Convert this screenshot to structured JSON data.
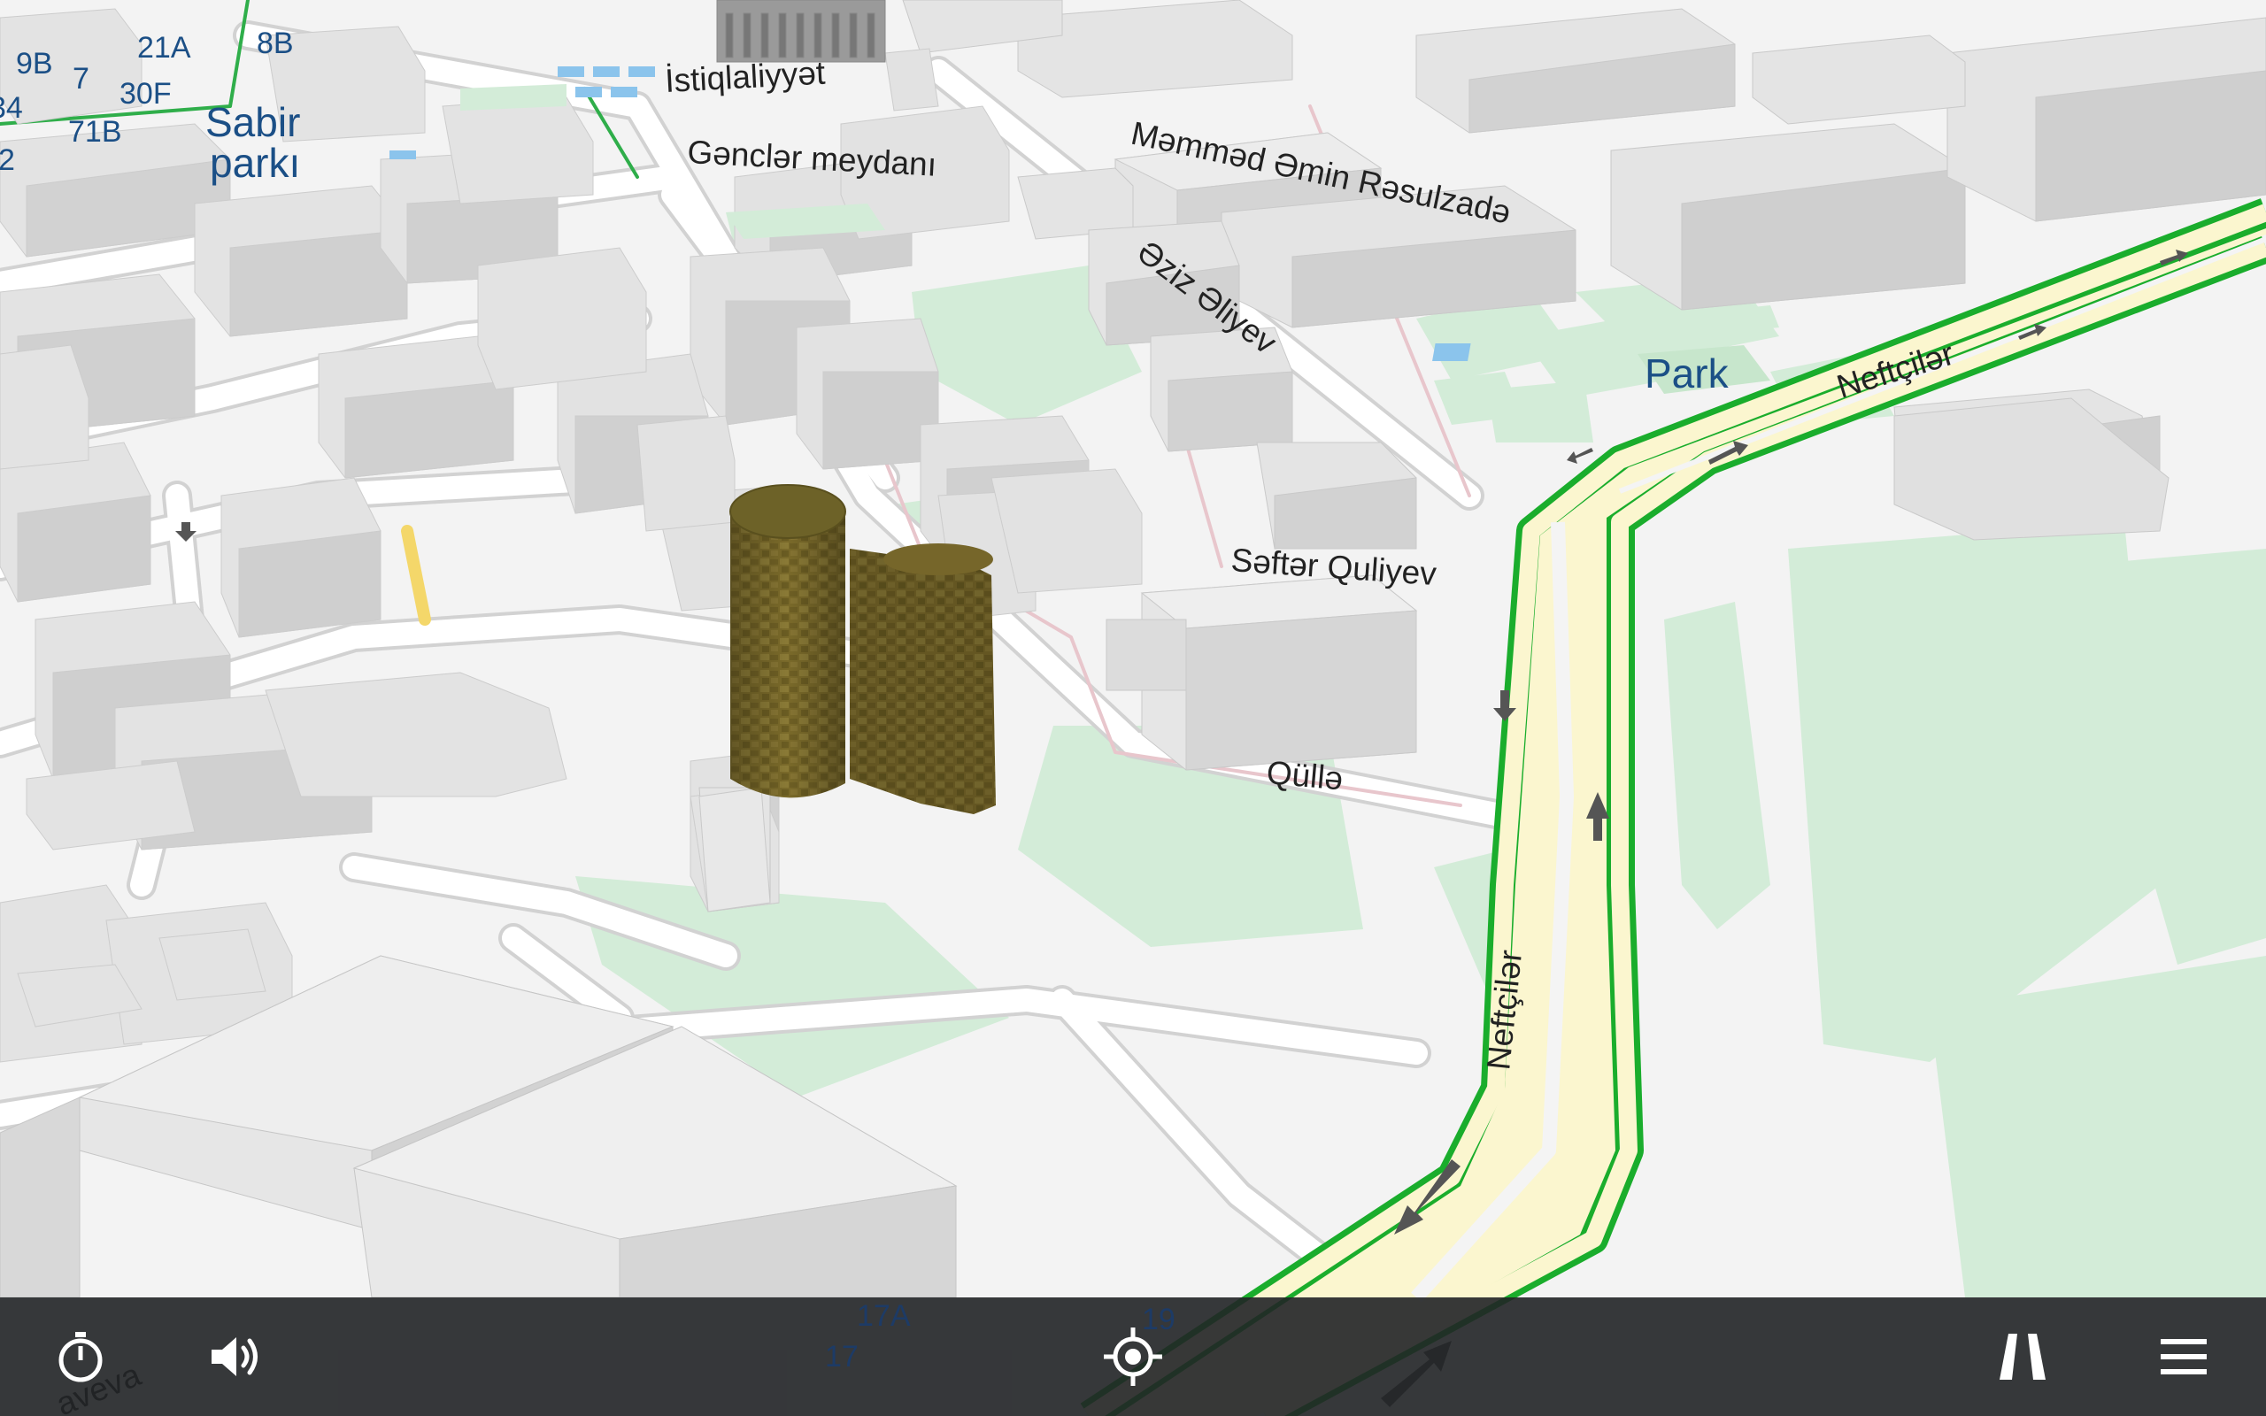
{
  "map": {
    "streets": {
      "istiqlaliyyet": "İstiqlaliyyət",
      "genclar": "Gənclər meydanı",
      "memmed": "Məmməd Əmin Rəsulzadə",
      "eziz": "Əziz Əliyev",
      "sefter": "Səftər Quliyev",
      "qulle": "Qüllə",
      "neftciler_top": "Neftçilər",
      "neftciler_side": "Neftçilər",
      "aveva": "aveva"
    },
    "places": {
      "sabir_line1": "Sabir",
      "sabir_line2": "parkı",
      "park": "Park"
    },
    "house_numbers": [
      "9B",
      "7",
      "21A",
      "8B",
      "30F",
      "71B",
      "34",
      "2"
    ],
    "bottom_numbers": [
      "17A",
      "17",
      "19"
    ],
    "colors": {
      "route_green": "#1aad2c",
      "road_fill": "#fbf6cf",
      "park_green": "#d3ecd8",
      "building": "#dadada",
      "place_label": "#1b4f86"
    }
  },
  "toolbar": {
    "icons": [
      "timer-icon",
      "volume-icon",
      "locate-icon",
      "road-view-icon",
      "menu-icon"
    ]
  }
}
